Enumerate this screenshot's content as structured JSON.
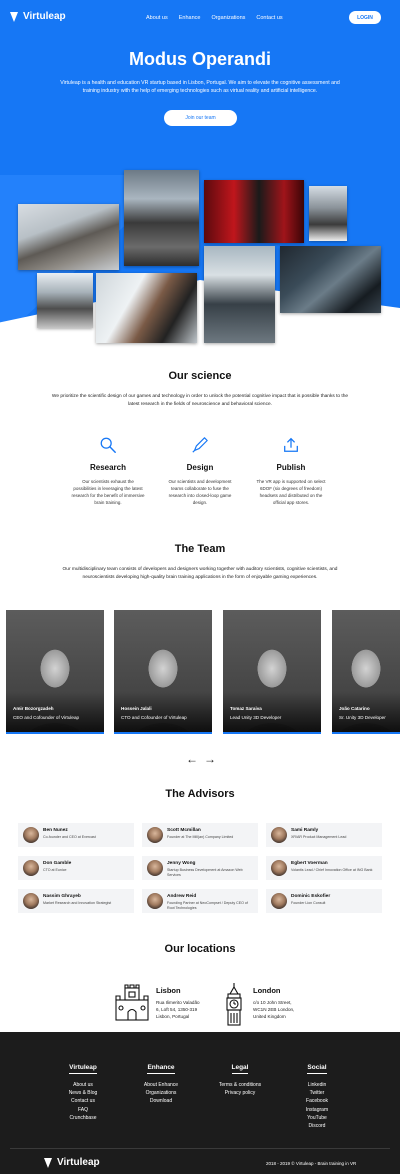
{
  "nav": {
    "logo": "Virtuleap",
    "links": [
      "About us",
      "Enhance",
      "Organizations",
      "Contact us"
    ],
    "login": "LOGIN"
  },
  "hero": {
    "title": "Modus Operandi",
    "text": "Virtuleap is a health and education VR startup based in Lisbon, Portugal. We aim to elevate the cognitive assessment and training industry with the help of emerging technologies such as virtual reality and artificial intelligence.",
    "cta": "Join our team"
  },
  "science": {
    "title": "Our science",
    "text": "We prioritize the scientific design of our games and technology in order to unlock the potential cognitive impact that is possible thanks to the latest research in the fields of neuroscience and behavioral science.",
    "features": [
      {
        "icon": "magnifier-icon",
        "title": "Research",
        "text": "Our scientists exhaust the possibilities in leveraging the latest research for the benefit of immersive brain training."
      },
      {
        "icon": "pen-icon",
        "title": "Design",
        "text": "Our scientists and development teams collaborate to fuse the research into closed-loop game design."
      },
      {
        "icon": "upload-icon",
        "title": "Publish",
        "text": "The VR app is supported on select 6DOF (six degrees of freedom) headsets and distributed on the official app stores."
      }
    ]
  },
  "team": {
    "title": "The Team",
    "text": "Our multidisciplinary team consists of developers and designers working together with auditory scientists, cognitive scientists, and neuroscientists developing high-quality brain training applications in the form of enjoyable gaming experiences.",
    "members": [
      {
        "name": "Amir Bozorgzadeh",
        "role": "CEO and Cofounder of Virtuleap"
      },
      {
        "name": "Hossein Jalali",
        "role": "CTO and Cofounder of Virtuleap"
      },
      {
        "name": "Tomaz Saraiva",
        "role": "Lead Unity 3D Developer"
      },
      {
        "name": "João Catarino",
        "role": "Sr. Unity 3D Developer"
      }
    ],
    "prev": "←",
    "next": "→"
  },
  "advisors": {
    "title": "The Advisors",
    "items": [
      {
        "name": "Ben Nunez",
        "role": "Co-founder and CEO at Evercast"
      },
      {
        "name": "Scott Mcmillan",
        "role": "Founder at The Mill(an) Company Limited"
      },
      {
        "name": "Sami Ramly",
        "role": "XR/AR Product Management Lead"
      },
      {
        "name": "Don Gamble",
        "role": "CTO at Eunice"
      },
      {
        "name": "Jenny Wong",
        "role": "Startup Business Development at Amazon Web Services"
      },
      {
        "name": "Egbert Voerman",
        "role": "Volantis Lead / Chief Innovation Office at ING Bank"
      },
      {
        "name": "Nassim Ghrayeb",
        "role": "Market Research and Innovation Strategist"
      },
      {
        "name": "Andrew Reid",
        "role": "Founding Partner at NeoCompset / Deputy CEO of Root Technologies"
      },
      {
        "name": "Dominic Eskofier",
        "role": "Founder Lion Consult"
      }
    ]
  },
  "locations": {
    "title": "Our locations",
    "items": [
      {
        "city": "Lisbon",
        "address": [
          "Rua Ilimerito Valadão",
          "6, Loft 54, 1350-319",
          "Lisbon, Portugal"
        ]
      },
      {
        "city": "London",
        "address": [
          "c/o 10 John Street,",
          "WC1N 2EB London,",
          "United Kingdom"
        ]
      }
    ]
  },
  "footer": {
    "columns": [
      {
        "title": "Virtuleap",
        "links": [
          "About us",
          "News & Blog",
          "Contact us",
          "FAQ",
          "Crunchbase"
        ]
      },
      {
        "title": "Enhance",
        "links": [
          "About Enhance",
          "Organizations",
          "Download"
        ]
      },
      {
        "title": "Legal",
        "links": [
          "Terms & conditions",
          "Privacy policy"
        ]
      },
      {
        "title": "Social",
        "links": [
          "Linkedin",
          "Twitter",
          "Facebook",
          "Instagram",
          "YouTube",
          "Discord"
        ]
      }
    ],
    "logo": "Virtuleap",
    "copyright": "2018 - 2019 © Virtuleap - Brain training in VR"
  },
  "colors": {
    "accent": "#1677f5",
    "footer": "#1c1c1c"
  }
}
